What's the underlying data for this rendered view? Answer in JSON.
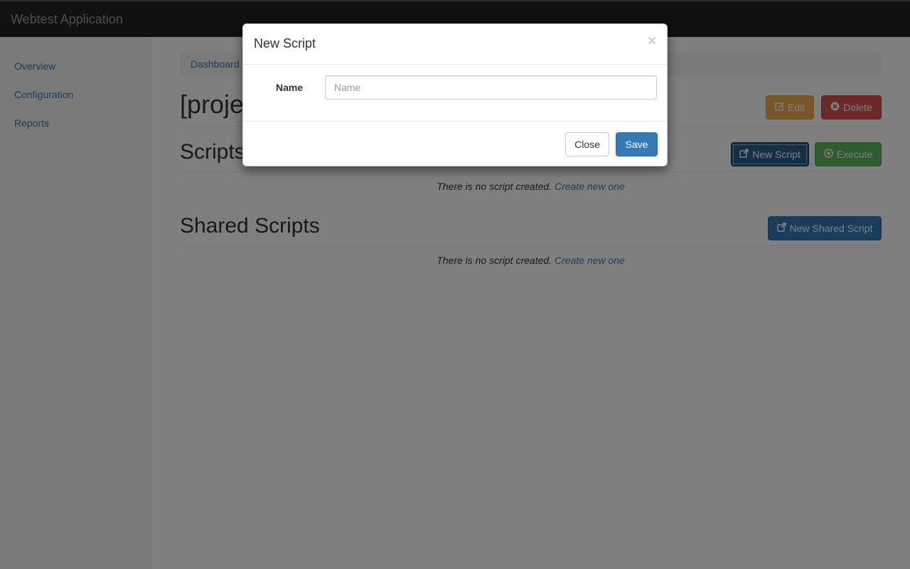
{
  "app": {
    "title": "Webtest Application"
  },
  "sidebar": {
    "items": [
      {
        "label": "Overview"
      },
      {
        "label": "Configuration"
      },
      {
        "label": "Reports"
      }
    ]
  },
  "breadcrumb": {
    "item": "Dashboard"
  },
  "page": {
    "title": "[proje",
    "edit_label": "Edit",
    "delete_label": "Delete"
  },
  "scripts": {
    "title": "Scripts",
    "new_label": "New Script",
    "execute_label": "Execute",
    "empty_text": "There is no script created.",
    "create_link": "Create new one"
  },
  "shared_scripts": {
    "title": "Shared Scripts",
    "new_label": "New Shared Script",
    "empty_text": "There is no script created.",
    "create_link": "Create new one"
  },
  "modal": {
    "title": "New Script",
    "close_symbol": "×",
    "name_label": "Name",
    "name_placeholder": "Name",
    "name_value": "",
    "close_label": "Close",
    "save_label": "Save"
  },
  "colors": {
    "navbar": "#222222",
    "primary": "#337ab7",
    "warning": "#f0ad4e",
    "danger": "#d9534f",
    "success": "#5cb85c"
  },
  "icons": {
    "edit": "edit-icon",
    "delete": "times-circle-icon",
    "new": "external-link-icon",
    "execute": "play-circle-icon",
    "close": "close-icon"
  }
}
